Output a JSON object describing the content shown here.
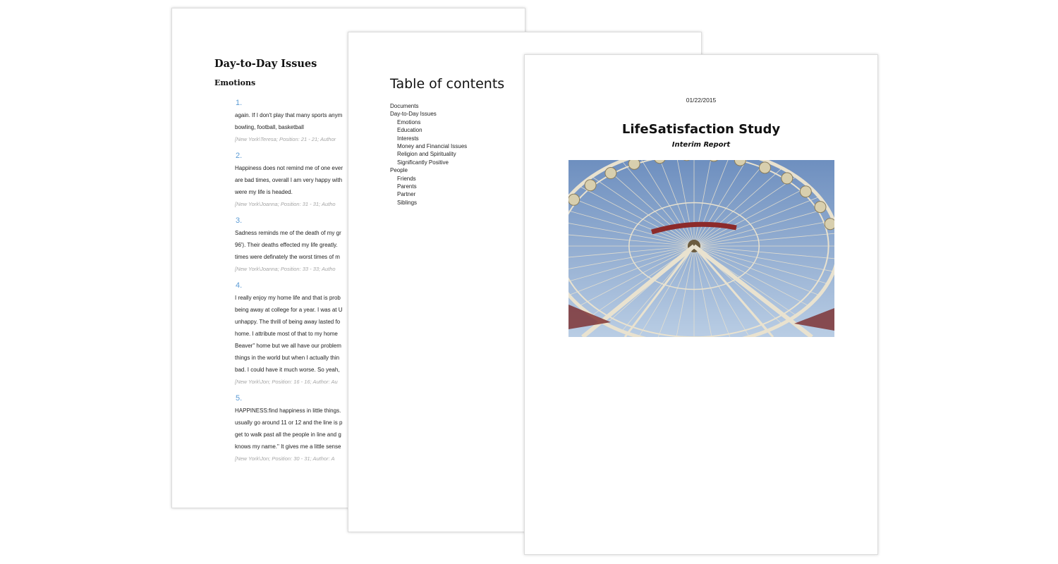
{
  "issues_page": {
    "heading": "Day-to-Day Issues",
    "subheading": "Emotions",
    "entries": [
      {
        "number": "1.",
        "lines": [
          "again.  If I don't play that many sports anym",
          "bowling, football, basketball"
        ],
        "source": "[New York\\Teresa; Position: 21 - 21; Author"
      },
      {
        "number": "2.",
        "lines": [
          "Happiness does not remind me of one ever",
          "are bad times, overall I am very happy with",
          "were my life is headed."
        ],
        "source": "[New York\\Joanna; Position: 31 - 31; Autho"
      },
      {
        "number": "3.",
        "lines": [
          "Sadness reminds me of the death of my gr",
          "96').  Their deaths effected my life greatly.",
          "times were definately the worst times of m"
        ],
        "source": "[New York\\Joanna; Position: 33 - 33; Autho"
      },
      {
        "number": "4.",
        "lines": [
          "I really enjoy my home life and that is prob",
          "being away at college for a year.  I was at U",
          "unhappy.  The thrill of being away lasted fo",
          "home.  I attribute most of that to my home",
          "Beaver\" home but we all have our problem",
          "things in the world but when I actually thin",
          "bad.  I could have it much worse.  So yeah,"
        ],
        "source": "[New York\\Jon; Position: 16 - 16; Author: Au"
      },
      {
        "number": "5.",
        "lines": [
          "HAPPINESS:find happiness in little things.",
          "usually go around 11 or 12 and the line is p",
          "get to walk past all the people in line and g",
          "knows my name.\"  It gives me a little sense"
        ],
        "source": "[New York\\Jon; Position: 30 - 31; Author: A"
      }
    ]
  },
  "toc_page": {
    "heading": "Table of contents",
    "items": [
      {
        "label": "Documents",
        "level": 1
      },
      {
        "label": "Day-to-Day Issues",
        "level": 1
      },
      {
        "label": "Emotions",
        "level": 2
      },
      {
        "label": "Education",
        "level": 2
      },
      {
        "label": "Interests",
        "level": 2
      },
      {
        "label": "Money and Financial Issues",
        "level": 2
      },
      {
        "label": "Religion and Spirituality",
        "level": 2
      },
      {
        "label": "Significantly Positive",
        "level": 2
      },
      {
        "label": "People",
        "level": 1
      },
      {
        "label": "Friends",
        "level": 2
      },
      {
        "label": "Parents",
        "level": 2
      },
      {
        "label": "Partner",
        "level": 2
      },
      {
        "label": "Siblings",
        "level": 2
      }
    ]
  },
  "title_page": {
    "date": "01/22/2015",
    "title": "LifeSatisfaction Study",
    "subtitle": "Interim Report",
    "image": "ferris-wheel-photo"
  },
  "colors": {
    "entry_number": "#5b9bd5",
    "source_text": "#a5a5a5",
    "sky_top": "#6e8fbf",
    "sky_bottom": "#b9cde4",
    "wheel_frame": "#e9e2cf"
  }
}
